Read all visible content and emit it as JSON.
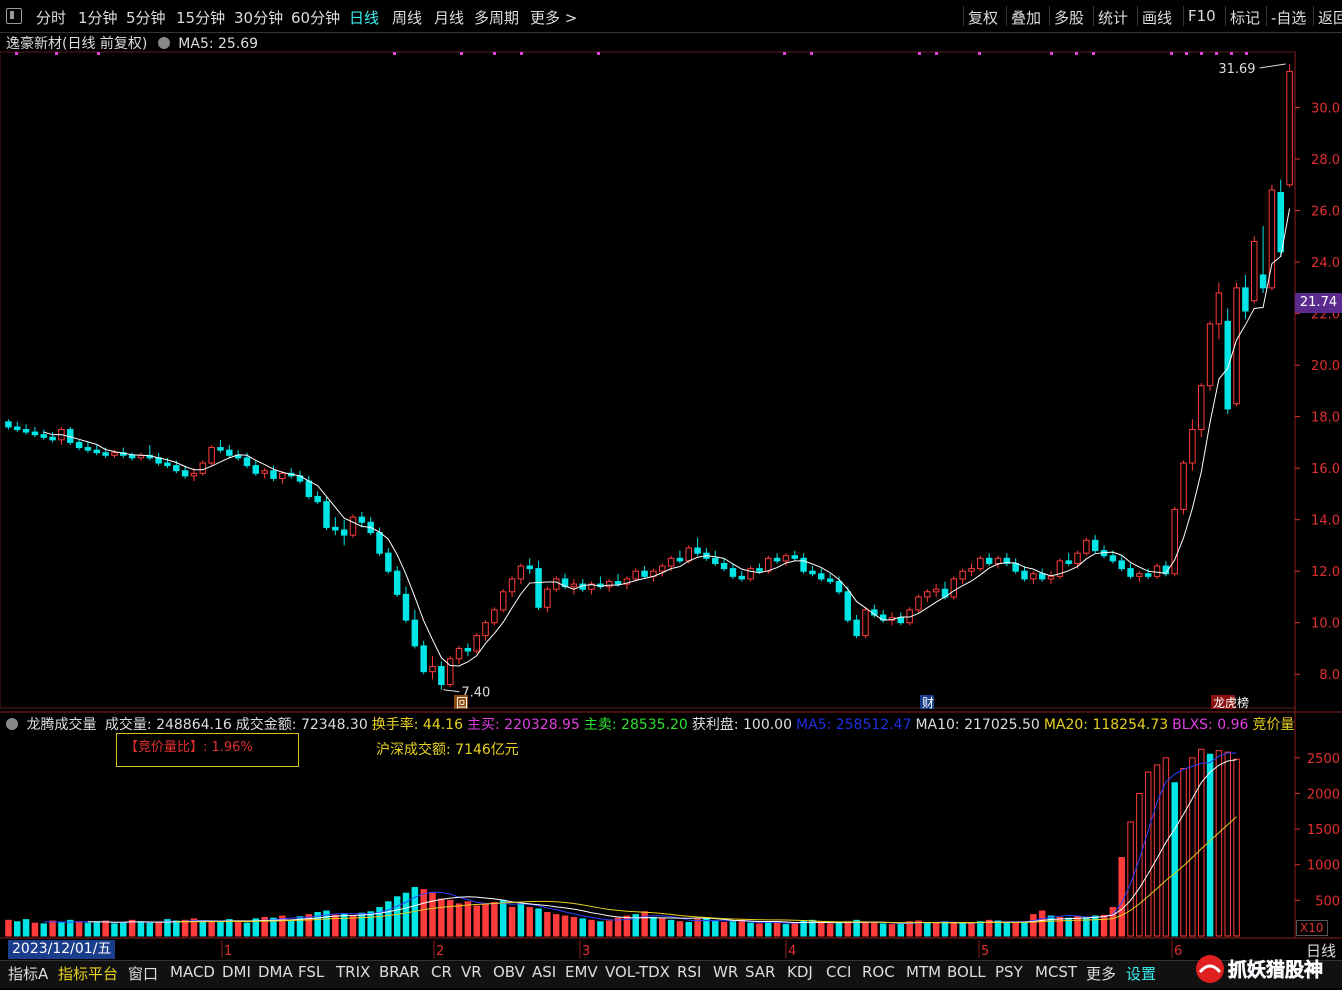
{
  "toolbar": {
    "periods": [
      "分时",
      "1分钟",
      "5分钟",
      "15分钟",
      "30分钟",
      "60分钟",
      "日线",
      "周线",
      "月线",
      "多周期",
      "更多 >"
    ],
    "active_period": "日线",
    "right_items": [
      "复权",
      "叠加",
      "多股",
      "统计",
      "画线",
      "F10",
      "标记",
      "-自选",
      "返回"
    ]
  },
  "info": {
    "title": "逸豪新材(日线 前复权)",
    "ma5_label": "MA5: 25.69"
  },
  "price_axis": {
    "ticks": [
      "30.0",
      "28.0",
      "26.0",
      "24.0",
      "22.0",
      "20.0",
      "18.0",
      "16.0",
      "14.0",
      "12.0",
      "10.0",
      "8.0"
    ],
    "current": "21.74"
  },
  "annotations": {
    "high": "31.69",
    "low": "7.40",
    "marker_hui": "回",
    "marker_cai": "财",
    "marker_bang": "龙虎榜"
  },
  "volume": {
    "title": "龙腾成交量",
    "items": [
      {
        "label": "成交量: 248864.16",
        "color": "#dddddd"
      },
      {
        "label": "成交金额: 72348.30",
        "color": "#dddddd"
      },
      {
        "label": "换手率: 44.16",
        "color": "#e8d020"
      },
      {
        "label": "主买: 220328.95",
        "color": "#e040e0"
      },
      {
        "label": "主卖: 28535.20",
        "color": "#30e030"
      },
      {
        "label": "获利盘: 100.00",
        "color": "#dddddd"
      },
      {
        "label": "MA5: 258512.47",
        "color": "#2030e0"
      },
      {
        "label": "MA10: 217025.50",
        "color": "#dddddd"
      },
      {
        "label": "MA20: 118254.73",
        "color": "#e8d020"
      },
      {
        "label": "BLXS: 0.96",
        "color": "#e040e0"
      },
      {
        "label": "竞价量",
        "color": "#e8d020"
      }
    ],
    "ratio_box": "【竞价量比】: 1.96%",
    "turnover_total": "沪深成交额: 7146亿元",
    "axis": [
      "2500",
      "2000",
      "1500",
      "1000",
      "500"
    ],
    "multiplier": "X10"
  },
  "datebar": {
    "date": "2023/12/01/五",
    "months": [
      "1",
      "2",
      "3",
      "4",
      "5",
      "6"
    ],
    "period_label": "日线"
  },
  "tabs": [
    "指标A",
    "指标平台",
    "窗口",
    "MACD",
    "DMI",
    "DMA",
    "FSL",
    "TRIX",
    "BRAR",
    "CR",
    "VR",
    "OBV",
    "ASI",
    "EMV",
    "VOL-TDX",
    "RSI",
    "WR",
    "SAR",
    "KDJ",
    "CCI",
    "ROC",
    "MTM",
    "BOLL",
    "PSY",
    "MCST",
    "更多",
    "设置"
  ],
  "active_tab": "指标平台",
  "watermark": "抓妖猎股神",
  "colors": {
    "up": "#ff3b3b",
    "down": "#00e5e5",
    "ma": "#ffffff",
    "axis": "#e03030"
  },
  "chart_data": {
    "type": "candlestick",
    "ylim": [
      7,
      32
    ],
    "ma_line": "MA5",
    "ohlc": [
      [
        17.8,
        17.9,
        17.5,
        17.6
      ],
      [
        17.6,
        17.8,
        17.4,
        17.5
      ],
      [
        17.5,
        17.7,
        17.3,
        17.4
      ],
      [
        17.4,
        17.6,
        17.2,
        17.3
      ],
      [
        17.3,
        17.5,
        17.1,
        17.2
      ],
      [
        17.2,
        17.4,
        17.0,
        17.1
      ],
      [
        17.1,
        17.6,
        16.9,
        17.5
      ],
      [
        17.5,
        17.6,
        16.9,
        17.0
      ],
      [
        17.0,
        17.1,
        16.7,
        16.8
      ],
      [
        16.8,
        17.0,
        16.6,
        16.7
      ],
      [
        16.7,
        16.9,
        16.5,
        16.6
      ],
      [
        16.6,
        16.8,
        16.4,
        16.5
      ],
      [
        16.5,
        16.7,
        16.4,
        16.6
      ],
      [
        16.6,
        16.8,
        16.4,
        16.5
      ],
      [
        16.5,
        16.6,
        16.3,
        16.4
      ],
      [
        16.4,
        16.6,
        16.3,
        16.5
      ],
      [
        16.5,
        16.9,
        16.3,
        16.4
      ],
      [
        16.4,
        16.6,
        16.1,
        16.2
      ],
      [
        16.2,
        16.4,
        16.0,
        16.1
      ],
      [
        16.1,
        16.3,
        15.8,
        15.9
      ],
      [
        15.9,
        16.1,
        15.6,
        15.7
      ],
      [
        15.7,
        16.0,
        15.5,
        15.8
      ],
      [
        15.8,
        16.3,
        15.7,
        16.2
      ],
      [
        16.2,
        16.9,
        16.1,
        16.8
      ],
      [
        16.8,
        17.1,
        16.6,
        16.7
      ],
      [
        16.7,
        16.9,
        16.4,
        16.5
      ],
      [
        16.5,
        16.7,
        16.3,
        16.4
      ],
      [
        16.4,
        16.6,
        16.0,
        16.1
      ],
      [
        16.1,
        16.3,
        15.7,
        15.8
      ],
      [
        15.8,
        16.0,
        15.6,
        15.9
      ],
      [
        15.9,
        16.1,
        15.5,
        15.6
      ],
      [
        15.6,
        15.9,
        15.4,
        15.8
      ],
      [
        15.8,
        16.0,
        15.6,
        15.7
      ],
      [
        15.7,
        15.9,
        15.4,
        15.5
      ],
      [
        15.5,
        15.7,
        14.8,
        14.9
      ],
      [
        14.9,
        15.1,
        14.6,
        14.7
      ],
      [
        14.7,
        14.9,
        13.6,
        13.7
      ],
      [
        13.7,
        14.1,
        13.4,
        13.6
      ],
      [
        13.6,
        14.0,
        13.0,
        13.4
      ],
      [
        13.4,
        14.2,
        13.3,
        14.1
      ],
      [
        14.1,
        14.3,
        13.7,
        13.9
      ],
      [
        13.9,
        14.1,
        13.4,
        13.5
      ],
      [
        13.5,
        13.7,
        12.6,
        12.7
      ],
      [
        12.7,
        12.9,
        11.9,
        12.0
      ],
      [
        12.0,
        12.2,
        11.0,
        11.1
      ],
      [
        11.1,
        11.4,
        10.0,
        10.1
      ],
      [
        10.1,
        10.5,
        9.0,
        9.1
      ],
      [
        9.1,
        9.3,
        8.0,
        8.1
      ],
      [
        8.1,
        8.7,
        7.8,
        8.3
      ],
      [
        8.3,
        8.5,
        7.4,
        7.6
      ],
      [
        7.6,
        8.7,
        7.5,
        8.6
      ],
      [
        8.6,
        9.1,
        8.4,
        9.0
      ],
      [
        9.0,
        9.2,
        8.7,
        8.9
      ],
      [
        8.9,
        9.6,
        8.8,
        9.5
      ],
      [
        9.5,
        10.1,
        9.3,
        10.0
      ],
      [
        10.0,
        10.6,
        9.9,
        10.5
      ],
      [
        10.5,
        11.3,
        10.4,
        11.2
      ],
      [
        11.2,
        11.8,
        11.0,
        11.7
      ],
      [
        11.7,
        12.3,
        11.5,
        12.2
      ],
      [
        12.2,
        12.5,
        11.9,
        12.1
      ],
      [
        12.1,
        12.4,
        10.5,
        10.6
      ],
      [
        10.6,
        11.4,
        10.4,
        11.3
      ],
      [
        11.3,
        11.8,
        11.2,
        11.7
      ],
      [
        11.7,
        11.9,
        11.3,
        11.4
      ],
      [
        11.4,
        11.7,
        11.1,
        11.5
      ],
      [
        11.5,
        11.7,
        11.2,
        11.3
      ],
      [
        11.3,
        11.6,
        11.1,
        11.5
      ],
      [
        11.5,
        11.8,
        11.3,
        11.4
      ],
      [
        11.4,
        11.7,
        11.2,
        11.6
      ],
      [
        11.6,
        11.9,
        11.4,
        11.5
      ],
      [
        11.5,
        11.8,
        11.3,
        11.7
      ],
      [
        11.7,
        12.1,
        11.6,
        12.0
      ],
      [
        12.0,
        12.2,
        11.7,
        11.8
      ],
      [
        11.8,
        12.1,
        11.6,
        12.0
      ],
      [
        12.0,
        12.3,
        11.8,
        12.2
      ],
      [
        12.2,
        12.6,
        12.0,
        12.5
      ],
      [
        12.5,
        12.8,
        12.3,
        12.4
      ],
      [
        12.4,
        13.0,
        12.3,
        12.9
      ],
      [
        12.9,
        13.3,
        12.6,
        12.7
      ],
      [
        12.7,
        12.9,
        12.4,
        12.5
      ],
      [
        12.5,
        12.8,
        12.2,
        12.3
      ],
      [
        12.3,
        12.5,
        12.0,
        12.1
      ],
      [
        12.1,
        12.3,
        11.7,
        11.8
      ],
      [
        11.8,
        12.0,
        11.6,
        11.7
      ],
      [
        11.7,
        12.2,
        11.6,
        12.1
      ],
      [
        12.1,
        12.3,
        11.9,
        12.0
      ],
      [
        12.0,
        12.6,
        11.9,
        12.5
      ],
      [
        12.5,
        12.7,
        12.3,
        12.4
      ],
      [
        12.4,
        12.7,
        12.2,
        12.6
      ],
      [
        12.6,
        12.8,
        12.4,
        12.5
      ],
      [
        12.5,
        12.7,
        11.9,
        12.0
      ],
      [
        12.0,
        12.2,
        11.8,
        11.9
      ],
      [
        11.9,
        12.1,
        11.6,
        11.7
      ],
      [
        11.7,
        11.9,
        11.5,
        11.6
      ],
      [
        11.6,
        11.8,
        11.1,
        11.2
      ],
      [
        11.2,
        11.4,
        10.0,
        10.1
      ],
      [
        10.1,
        10.3,
        9.4,
        9.5
      ],
      [
        9.5,
        10.6,
        9.4,
        10.5
      ],
      [
        10.5,
        10.7,
        10.2,
        10.3
      ],
      [
        10.3,
        10.5,
        10.0,
        10.1
      ],
      [
        10.1,
        10.4,
        9.9,
        10.2
      ],
      [
        10.2,
        10.4,
        9.9,
        10.0
      ],
      [
        10.0,
        10.6,
        9.9,
        10.5
      ],
      [
        10.5,
        11.1,
        10.4,
        11.0
      ],
      [
        11.0,
        11.3,
        10.8,
        11.2
      ],
      [
        11.2,
        11.5,
        11.0,
        11.3
      ],
      [
        11.3,
        11.6,
        10.9,
        11.0
      ],
      [
        11.0,
        11.8,
        10.9,
        11.7
      ],
      [
        11.7,
        12.1,
        11.5,
        12.0
      ],
      [
        12.0,
        12.3,
        11.8,
        12.1
      ],
      [
        12.1,
        12.6,
        12.0,
        12.5
      ],
      [
        12.5,
        12.7,
        12.2,
        12.3
      ],
      [
        12.3,
        12.6,
        12.1,
        12.5
      ],
      [
        12.5,
        12.7,
        12.2,
        12.3
      ],
      [
        12.3,
        12.5,
        11.9,
        12.0
      ],
      [
        12.0,
        12.2,
        11.6,
        11.7
      ],
      [
        11.7,
        12.0,
        11.5,
        11.9
      ],
      [
        11.9,
        12.1,
        11.6,
        11.7
      ],
      [
        11.7,
        12.0,
        11.5,
        11.8
      ],
      [
        11.8,
        12.5,
        11.7,
        12.4
      ],
      [
        12.4,
        12.7,
        12.2,
        12.3
      ],
      [
        12.3,
        12.8,
        12.1,
        12.7
      ],
      [
        12.7,
        13.3,
        12.6,
        13.2
      ],
      [
        13.2,
        13.4,
        12.7,
        12.8
      ],
      [
        12.8,
        13.0,
        12.5,
        12.6
      ],
      [
        12.6,
        12.8,
        12.3,
        12.4
      ],
      [
        12.4,
        12.6,
        12.0,
        12.1
      ],
      [
        12.1,
        12.3,
        11.7,
        11.8
      ],
      [
        11.8,
        12.0,
        11.6,
        11.9
      ],
      [
        11.9,
        12.1,
        11.7,
        11.8
      ],
      [
        11.8,
        12.3,
        11.7,
        12.2
      ],
      [
        12.2,
        12.4,
        11.8,
        11.9
      ],
      [
        11.9,
        14.5,
        11.8,
        14.4
      ],
      [
        14.4,
        16.3,
        14.2,
        16.2
      ],
      [
        16.2,
        17.9,
        15.9,
        17.5
      ],
      [
        17.5,
        19.3,
        17.2,
        19.2
      ],
      [
        19.2,
        21.7,
        19.0,
        21.6
      ],
      [
        21.6,
        23.2,
        21.0,
        22.8
      ],
      [
        21.7,
        22.2,
        18.1,
        18.3
      ],
      [
        18.5,
        23.2,
        18.4,
        23.0
      ],
      [
        23.0,
        23.5,
        21.8,
        22.1
      ],
      [
        22.5,
        25.0,
        22.4,
        24.8
      ],
      [
        23.5,
        25.4,
        22.8,
        23.0
      ],
      [
        23.0,
        27.0,
        22.9,
        26.8
      ],
      [
        26.7,
        27.2,
        24.2,
        24.4
      ],
      [
        27.0,
        31.69,
        26.9,
        31.4
      ]
    ],
    "volume": [
      [
        22,
        1
      ],
      [
        20,
        0
      ],
      [
        23,
        0
      ],
      [
        18,
        1
      ],
      [
        17,
        0
      ],
      [
        21,
        1
      ],
      [
        19,
        0
      ],
      [
        22,
        0
      ],
      [
        20,
        1
      ],
      [
        18,
        0
      ],
      [
        20,
        0
      ],
      [
        21,
        1
      ],
      [
        17,
        0
      ],
      [
        19,
        0
      ],
      [
        22,
        1
      ],
      [
        20,
        0
      ],
      [
        18,
        0
      ],
      [
        19,
        1
      ],
      [
        23,
        0
      ],
      [
        21,
        0
      ],
      [
        22,
        1
      ],
      [
        24,
        1
      ],
      [
        20,
        0
      ],
      [
        19,
        1
      ],
      [
        21,
        0
      ],
      [
        23,
        0
      ],
      [
        20,
        1
      ],
      [
        18,
        0
      ],
      [
        24,
        0
      ],
      [
        26,
        1
      ],
      [
        25,
        0
      ],
      [
        28,
        1
      ],
      [
        22,
        0
      ],
      [
        27,
        0
      ],
      [
        30,
        1
      ],
      [
        33,
        0
      ],
      [
        35,
        0
      ],
      [
        29,
        1
      ],
      [
        31,
        0
      ],
      [
        28,
        1
      ],
      [
        32,
        0
      ],
      [
        34,
        0
      ],
      [
        40,
        0
      ],
      [
        48,
        0
      ],
      [
        55,
        0
      ],
      [
        60,
        0
      ],
      [
        68,
        0
      ],
      [
        65,
        1
      ],
      [
        60,
        1
      ],
      [
        52,
        1
      ],
      [
        50,
        1
      ],
      [
        45,
        1
      ],
      [
        48,
        1
      ],
      [
        42,
        1
      ],
      [
        44,
        1
      ],
      [
        47,
        1
      ],
      [
        50,
        0
      ],
      [
        40,
        1
      ],
      [
        45,
        0
      ],
      [
        40,
        1
      ],
      [
        38,
        0
      ],
      [
        33,
        1
      ],
      [
        30,
        1
      ],
      [
        28,
        1
      ],
      [
        26,
        1
      ],
      [
        24,
        0
      ],
      [
        22,
        1
      ],
      [
        20,
        0
      ],
      [
        21,
        1
      ],
      [
        25,
        1
      ],
      [
        28,
        1
      ],
      [
        30,
        0
      ],
      [
        34,
        1
      ],
      [
        26,
        0
      ],
      [
        24,
        1
      ],
      [
        22,
        0
      ],
      [
        20,
        1
      ],
      [
        19,
        0
      ],
      [
        23,
        1
      ],
      [
        25,
        0
      ],
      [
        21,
        0
      ],
      [
        19,
        1
      ],
      [
        20,
        0
      ],
      [
        22,
        1
      ],
      [
        18,
        0
      ],
      [
        17,
        1
      ],
      [
        19,
        0
      ],
      [
        20,
        1
      ],
      [
        16,
        0
      ],
      [
        18,
        1
      ],
      [
        21,
        0
      ],
      [
        22,
        0
      ],
      [
        19,
        1
      ],
      [
        17,
        1
      ],
      [
        18,
        0
      ],
      [
        20,
        1
      ],
      [
        22,
        0
      ],
      [
        19,
        1
      ],
      [
        18,
        1
      ],
      [
        17,
        0
      ],
      [
        16,
        1
      ],
      [
        18,
        0
      ],
      [
        20,
        1
      ],
      [
        21,
        1
      ],
      [
        19,
        0
      ],
      [
        18,
        1
      ],
      [
        20,
        0
      ],
      [
        19,
        1
      ],
      [
        17,
        0
      ],
      [
        18,
        1
      ],
      [
        20,
        0
      ],
      [
        22,
        1
      ],
      [
        21,
        0
      ],
      [
        19,
        0
      ],
      [
        18,
        1
      ],
      [
        20,
        0
      ],
      [
        30,
        1
      ],
      [
        35,
        1
      ],
      [
        28,
        0
      ],
      [
        26,
        1
      ],
      [
        25,
        0
      ],
      [
        27,
        1
      ],
      [
        26,
        0
      ],
      [
        28,
        0
      ],
      [
        29,
        1
      ],
      [
        40,
        1
      ],
      [
        110,
        1
      ],
      [
        160,
        1
      ],
      [
        200,
        1
      ],
      [
        230,
        1
      ],
      [
        240,
        1
      ],
      [
        250,
        1
      ],
      [
        215,
        0
      ],
      [
        235,
        1
      ],
      [
        250,
        1
      ],
      [
        262,
        1
      ],
      [
        255,
        0
      ],
      [
        260,
        1
      ],
      [
        258,
        1
      ],
      [
        248,
        1
      ]
    ]
  }
}
